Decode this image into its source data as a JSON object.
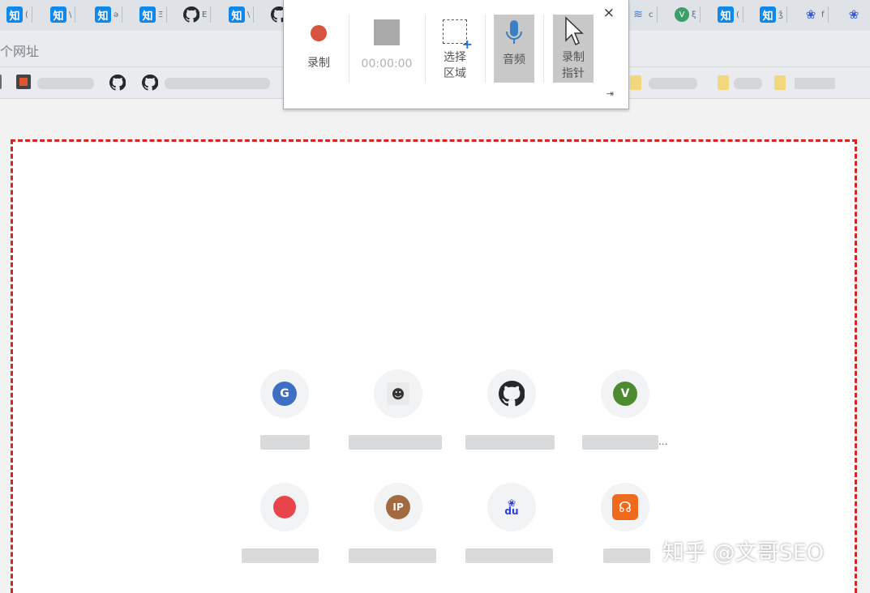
{
  "tabs": [
    {
      "icon": "zhihu-icon",
      "glyph": "知",
      "title": "("
    },
    {
      "icon": "zhihu-icon",
      "glyph": "知",
      "title": "\\"
    },
    {
      "icon": "zhihu-icon",
      "glyph": "知",
      "title": "ǝ"
    },
    {
      "icon": "zhihu-icon",
      "glyph": "知",
      "title": "Ξ"
    },
    {
      "icon": "github-icon",
      "glyph": "",
      "title": "E"
    },
    {
      "icon": "zhihu-icon",
      "glyph": "知",
      "title": "\\"
    },
    {
      "icon": "layers-icon",
      "glyph": "",
      "title": "c"
    },
    {
      "icon": "vue-icon",
      "glyph": "V",
      "title": "ξ"
    },
    {
      "icon": "zhihu-icon",
      "glyph": "知",
      "title": "("
    },
    {
      "icon": "zhihu-icon",
      "glyph": "知",
      "title": "ǯ"
    },
    {
      "icon": "baidu-paw-icon",
      "glyph": "❀",
      "title": "f"
    }
  ],
  "address_bar": {
    "placeholder": "个网址"
  },
  "recorder": {
    "record_label": "录制",
    "timer": "00:00:00",
    "select_area_label_1": "选择",
    "select_area_label_2": "区域",
    "audio_label": "音频",
    "record_pointer_label_1": "录制",
    "record_pointer_label_2": "指针",
    "close_symbol": "×",
    "pin_symbol": "⇥"
  },
  "shortcuts": {
    "row1": [
      {
        "icon": "google-g-icon",
        "glyph": "G"
      },
      {
        "icon": "avatar-icon",
        "glyph": "☻"
      },
      {
        "icon": "github-icon",
        "glyph": ""
      },
      {
        "icon": "vue-v-icon",
        "glyph": "V"
      }
    ],
    "row2": [
      {
        "icon": "red-shape-icon",
        "glyph": ""
      },
      {
        "icon": "ip-icon",
        "glyph": "IP"
      },
      {
        "icon": "baidu-du-icon",
        "glyph": "du"
      },
      {
        "icon": "music-app-icon",
        "glyph": "☊"
      }
    ],
    "ellipsis": "..."
  },
  "watermark": "知乎 @文哥SEO",
  "colors": {
    "capture_border": "#d32626",
    "record": "#d6533e",
    "zhihu": "#0f88eb"
  }
}
